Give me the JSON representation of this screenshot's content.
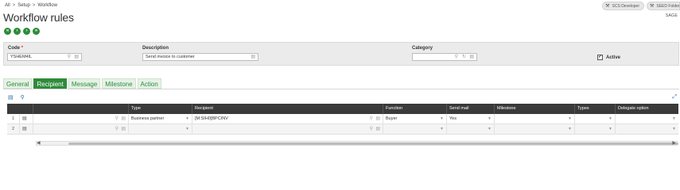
{
  "breadcrumb": {
    "items": [
      "All",
      "Setup",
      "Workflow"
    ],
    "separator": ">"
  },
  "top_right": {
    "developer": "SCS Developer",
    "folder": "SEED Folder"
  },
  "sage_label": "SAGE",
  "page_title": "Workflow rules",
  "nav_buttons": [
    "first",
    "previous",
    "next",
    "last"
  ],
  "criteria": {
    "code_label": "Code",
    "code_value": "YSHEM4IL",
    "description_label": "Description",
    "description_value": "Send invoice to customer",
    "category_label": "Category",
    "category_value": "",
    "active_label": "Active",
    "active_checked": true
  },
  "tabs": [
    "General",
    "Recipient",
    "Message",
    "Milestone",
    "Action"
  ],
  "active_tab": "Recipient",
  "grid": {
    "headers": {
      "type": "Type",
      "recipient": "Recipient",
      "function": "Function",
      "send_mail": "Send mail",
      "milestone": "Milestone",
      "types": "Types",
      "delegate": "Delegate option"
    },
    "rows": [
      {
        "num": "1",
        "type": "Business partner",
        "recipient": "[M:SIH0]BPCINV",
        "function": "Buyer",
        "send_mail": "Yes",
        "milestone": "",
        "types": "",
        "delegate": ""
      },
      {
        "num": "2",
        "type": "",
        "recipient": "",
        "function": "",
        "send_mail": "",
        "milestone": "",
        "types": "",
        "delegate": ""
      }
    ]
  },
  "colors": {
    "accent_green": "#2e8b3a",
    "grid_header": "#3a3a3a",
    "link_blue": "#2a6fad"
  }
}
